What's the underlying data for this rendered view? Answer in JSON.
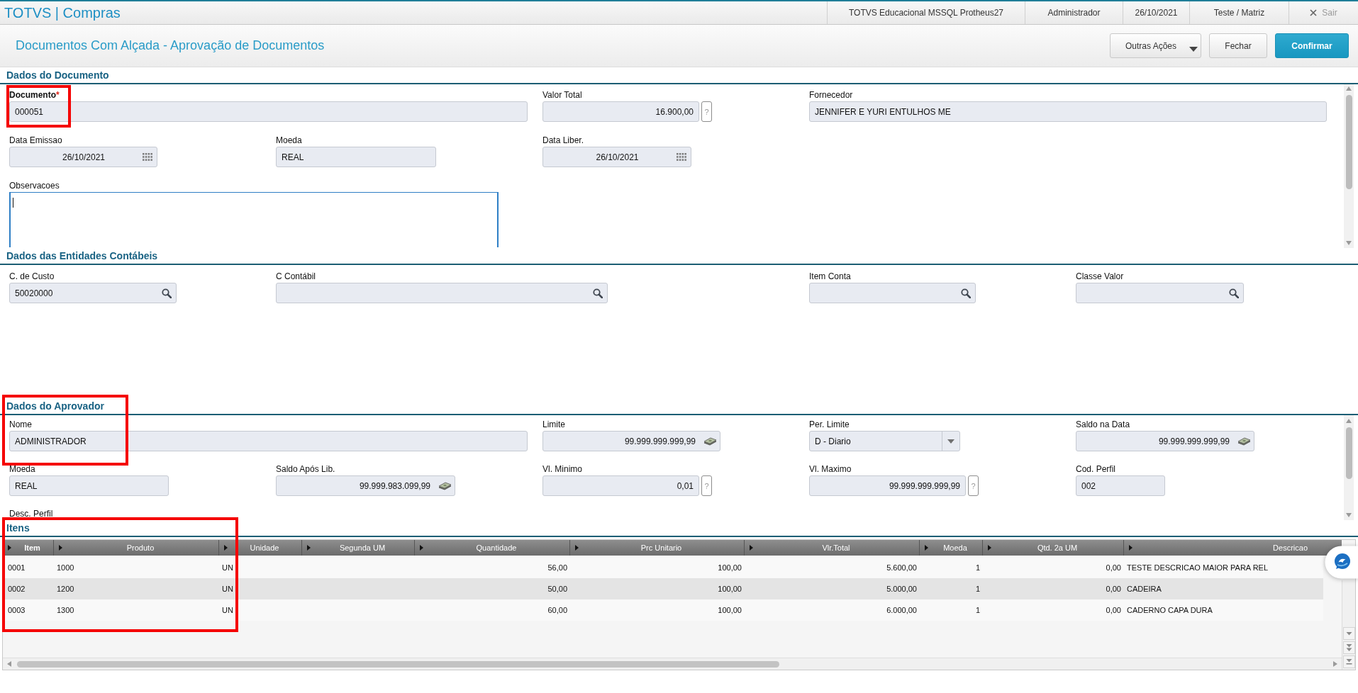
{
  "app_bar": {
    "brand": "TOTVS | Compras",
    "info": [
      "TOTVS Educacional MSSQL Protheus27",
      "Administrador",
      "26/10/2021",
      "Teste / Matriz"
    ],
    "exit_label": "Sair"
  },
  "page": {
    "title": "Documentos Com Alçada - Aprovação de Documentos",
    "actions": [
      {
        "label": "Outras Ações",
        "kind": "menu"
      },
      {
        "label": "Fechar",
        "kind": "default"
      },
      {
        "label": "Confirmar",
        "kind": "primary"
      }
    ]
  },
  "sections": [
    {
      "title": "Dados do Documento",
      "highlighted": false,
      "scrollbar": true,
      "fields": [
        {
          "label": "Documento",
          "required_mark": "*",
          "kind": "text",
          "value": "000051",
          "highlighted": true
        },
        {
          "label": "Valor Total",
          "kind": "number",
          "value": "16.900,00",
          "help": "?",
          "highlighted": false
        },
        {
          "label": "Fornecedor",
          "kind": "text",
          "value": "JENNIFER E YURI ENTULHOS ME",
          "highlighted": false
        },
        {
          "label": "Data Emissao",
          "kind": "date",
          "value": "26/10/2021",
          "highlighted": false
        },
        {
          "label": "Moeda",
          "kind": "text",
          "value": "REAL",
          "highlighted": false
        },
        {
          "label": "Data Liber.",
          "kind": "date",
          "value": "26/10/2021",
          "highlighted": false
        },
        {
          "label": "Observacoes",
          "kind": "textarea",
          "focused": true,
          "highlighted": false
        }
      ]
    },
    {
      "title": "Dados das Entidades Contábeis",
      "highlighted": false,
      "scrollbar": false,
      "fields": [
        {
          "label": "C. de Custo",
          "kind": "lookup",
          "value": "50020000",
          "highlighted": false
        },
        {
          "label": "C Contábil",
          "kind": "lookup",
          "highlighted": false
        },
        {
          "label": "Item Conta",
          "kind": "lookup",
          "highlighted": false
        },
        {
          "label": "Classe Valor",
          "kind": "lookup",
          "highlighted": false
        }
      ]
    },
    {
      "title": "Dados do Aprovador",
      "highlighted": true,
      "scrollbar": true,
      "fields": [
        {
          "label": "Nome",
          "kind": "text",
          "value": "ADMINISTRADOR",
          "highlighted": false
        },
        {
          "label": "Limite",
          "kind": "currency",
          "value": "99.999.999.999,99",
          "highlighted": false
        },
        {
          "label": "Per. Limite",
          "kind": "select",
          "value": "D - Diario",
          "highlighted": false
        },
        {
          "label": "Saldo na Data",
          "kind": "currency",
          "value": "99.999.999.999,99",
          "highlighted": false
        },
        {
          "label": "Moeda",
          "kind": "text",
          "value": "REAL",
          "highlighted": false
        },
        {
          "label": "Saldo Após Lib.",
          "kind": "currency",
          "value": "99.999.983.099,99",
          "highlighted": false
        },
        {
          "label": "Vl. Minimo",
          "kind": "number",
          "value": "0,01",
          "help": "?",
          "highlighted": false
        },
        {
          "label": "Vl. Maximo",
          "kind": "number",
          "value": "99.999.999.999,99",
          "help": "?",
          "highlighted": false
        },
        {
          "label": "Cod. Perfil",
          "kind": "text",
          "value": "002",
          "highlighted": false
        },
        {
          "label": "Desc. Perfil",
          "kind": "label",
          "highlighted": false
        }
      ]
    }
  ],
  "items": {
    "title": "Itens",
    "highlighted": true,
    "columns": [
      {
        "label": "Item",
        "kind": "text",
        "sorted": true
      },
      {
        "label": "Produto",
        "kind": "text",
        "sorted": false
      },
      {
        "label": "Unidade",
        "kind": "text",
        "sorted": false
      },
      {
        "label": "Segunda UM",
        "sorted": false
      },
      {
        "label": "Quantidade",
        "kind": "number",
        "sorted": false
      },
      {
        "label": "Prc Unitario",
        "kind": "number",
        "sorted": false
      },
      {
        "label": "Vlr.Total",
        "kind": "number",
        "sorted": false
      },
      {
        "label": "Moeda",
        "kind": "number",
        "sorted": false
      },
      {
        "label": "Qtd. 2a UM",
        "kind": "number",
        "sorted": false
      },
      {
        "label": "Descricao",
        "kind": "text",
        "sorted": false
      }
    ],
    "rows": [
      [
        "0001",
        "1000",
        "UN",
        null,
        "56,00",
        "100,00",
        "5.600,00",
        "1",
        "0,00",
        "TESTE DESCRICAO MAIOR PARA REL"
      ],
      [
        "0002",
        "1200",
        "UN",
        null,
        "50,00",
        "100,00",
        "5.000,00",
        "1",
        "0,00",
        "CADEIRA"
      ],
      [
        "0003",
        "1300",
        "UN",
        null,
        "60,00",
        "100,00",
        "6.000,00",
        "1",
        "0,00",
        "CADERNO CAPA DURA"
      ]
    ]
  }
}
